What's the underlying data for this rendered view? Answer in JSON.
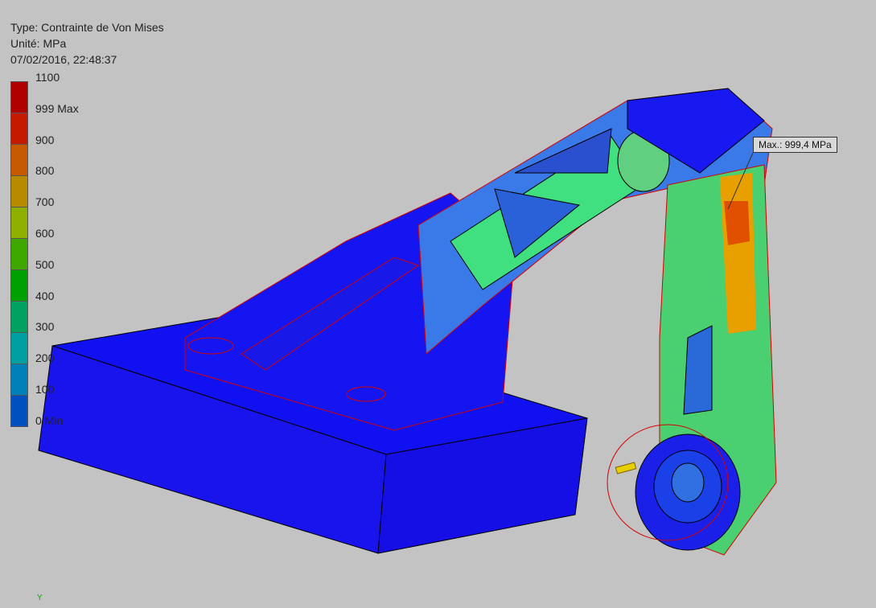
{
  "header": {
    "type_line": "Type: Contrainte de Von Mises",
    "unit_line": "Unité: MPa",
    "date_line": "07/02/2016, 22:48:37"
  },
  "legend": {
    "ticks": [
      "1100",
      "999 Max",
      "900",
      "800",
      "700",
      "600",
      "500",
      "400",
      "300",
      "200",
      "100",
      "0 Min"
    ],
    "colors": [
      "#b10000",
      "#c31a00",
      "#c65a00",
      "#b88a00",
      "#8fb000",
      "#3ea800",
      "#00a000",
      "#00a060",
      "#00a0a0",
      "#0080b8",
      "#0050c0",
      "#0018c0"
    ]
  },
  "annotation": {
    "max_label": "Max.: 999,4 MPa"
  },
  "axis_indicator": "Y",
  "colors": {
    "background": "#c3c3c3",
    "body_blue": "#1a10f0",
    "edge_red": "#d40000"
  }
}
